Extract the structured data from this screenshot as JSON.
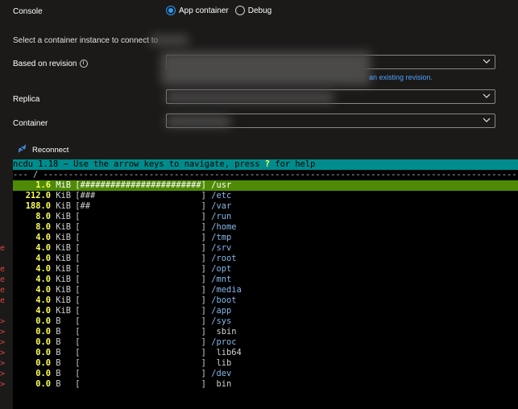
{
  "console": {
    "label": "Console",
    "options": [
      {
        "label": "App container",
        "selected": true
      },
      {
        "label": "Debug",
        "selected": false
      }
    ]
  },
  "instructions": "Select a container instance to connect to",
  "revision": {
    "label": "Based on revision",
    "link_text": "an existing revision."
  },
  "replica": {
    "label": "Replica"
  },
  "container": {
    "label": "Container"
  },
  "reconnect": {
    "label": "Reconnect"
  },
  "terminal": {
    "header_prefix": "ncdu 1.18 ~ Use the arrow keys to navigate, press ",
    "header_key": "?",
    "header_suffix": " for help",
    "dir_line": "--- / ----------------------------------------------------------------------------------------------------",
    "rows": [
      {
        "size": "1.6",
        "unit": "MiB",
        "bar": "[########################]",
        "name": "/usr",
        "flag": ""
      },
      {
        "size": "212.0",
        "unit": "KiB",
        "bar": "[###                     ]",
        "name": "/etc",
        "flag": ""
      },
      {
        "size": "188.0",
        "unit": "KiB",
        "bar": "[##                      ]",
        "name": "/var",
        "flag": ""
      },
      {
        "size": "8.0",
        "unit": "KiB",
        "bar": "[                        ]",
        "name": "/run",
        "flag": ""
      },
      {
        "size": "8.0",
        "unit": "KiB",
        "bar": "[                        ]",
        "name": "/home",
        "flag": ""
      },
      {
        "size": "4.0",
        "unit": "KiB",
        "bar": "[                        ]",
        "name": "/tmp",
        "flag": ""
      },
      {
        "size": "4.0",
        "unit": "KiB",
        "bar": "[                        ]",
        "name": "/srv",
        "flag": "e"
      },
      {
        "size": "4.0",
        "unit": "KiB",
        "bar": "[                        ]",
        "name": "/root",
        "flag": ""
      },
      {
        "size": "4.0",
        "unit": "KiB",
        "bar": "[                        ]",
        "name": "/opt",
        "flag": "e"
      },
      {
        "size": "4.0",
        "unit": "KiB",
        "bar": "[                        ]",
        "name": "/mnt",
        "flag": "e"
      },
      {
        "size": "4.0",
        "unit": "KiB",
        "bar": "[                        ]",
        "name": "/media",
        "flag": "e"
      },
      {
        "size": "4.0",
        "unit": "KiB",
        "bar": "[                        ]",
        "name": "/boot",
        "flag": "e"
      },
      {
        "size": "4.0",
        "unit": "KiB",
        "bar": "[                        ]",
        "name": "/app",
        "flag": ""
      },
      {
        "size": "0.0",
        "unit": "B",
        "bar": "[                        ]",
        "name": "/sys",
        "flag": ">"
      },
      {
        "size": "0.0",
        "unit": "B",
        "bar": "[                        ]",
        "name": " sbin",
        "flag": ">"
      },
      {
        "size": "0.0",
        "unit": "B",
        "bar": "[                        ]",
        "name": "/proc",
        "flag": ">"
      },
      {
        "size": "0.0",
        "unit": "B",
        "bar": "[                        ]",
        "name": " lib64",
        "flag": ">"
      },
      {
        "size": "0.0",
        "unit": "B",
        "bar": "[                        ]",
        "name": " lib",
        "flag": ">"
      },
      {
        "size": "0.0",
        "unit": "B",
        "bar": "[                        ]",
        "name": "/dev",
        "flag": ">"
      },
      {
        "size": "0.0",
        "unit": "B",
        "bar": "[                        ]",
        "name": " bin",
        "flag": ">"
      }
    ]
  }
}
